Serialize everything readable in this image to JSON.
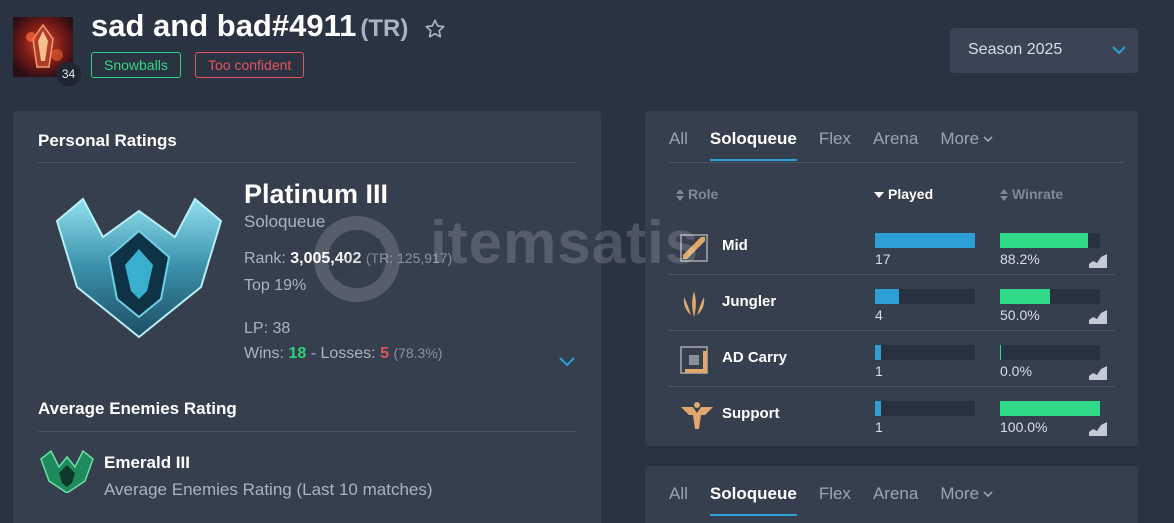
{
  "summoner": {
    "name": "sad and bad#4911",
    "region": "(TR)",
    "level": "34",
    "favorite_icon": "star-outline-icon"
  },
  "tags": [
    "Snowballs",
    "Too confident"
  ],
  "season_select": {
    "value": "Season 2025"
  },
  "personal_ratings": {
    "title": "Personal Ratings",
    "tier": "Platinum III",
    "queue": "Soloqueue",
    "rank_label": "Rank:",
    "rank_value": "3,005,402",
    "rank_region": "(TR: 125,917)",
    "top_percent": "Top 19%",
    "lp": "LP: 38",
    "wins_label": "Wins:",
    "wins": "18",
    "separator": "-",
    "losses_label": "Losses:",
    "losses": "5",
    "win_ratio": "(78.3%)"
  },
  "average_enemies": {
    "title": "Average Enemies Rating",
    "tier": "Emerald III",
    "description": "Average Enemies Rating (Last 10 matches)"
  },
  "queue_tabs": {
    "items": [
      "All",
      "Soloqueue",
      "Flex",
      "Arena",
      "More"
    ],
    "active": "Soloqueue"
  },
  "roles_table": {
    "headers": {
      "role": "Role",
      "played": "Played",
      "winrate": "Winrate"
    },
    "rows": [
      {
        "role": "Mid",
        "icon": "mid-lane-icon",
        "played": "17",
        "played_fraction": 1.0,
        "winrate": "88.2%",
        "winrate_fraction": 0.882
      },
      {
        "role": "Jungler",
        "icon": "jungle-icon",
        "played": "4",
        "played_fraction": 0.235,
        "winrate": "50.0%",
        "winrate_fraction": 0.5
      },
      {
        "role": "AD Carry",
        "icon": "bot-lane-icon",
        "played": "1",
        "played_fraction": 0.059,
        "winrate": "0.0%",
        "winrate_fraction": 0.0
      },
      {
        "role": "Support",
        "icon": "support-icon",
        "played": "1",
        "played_fraction": 0.059,
        "winrate": "100.0%",
        "winrate_fraction": 1.0
      }
    ]
  },
  "watermark": {
    "text": "itemsatis"
  },
  "colors": {
    "background": "#2a3342",
    "panel": "#363f4e",
    "accent_blue": "#2b9fd6",
    "win_green": "#30d988",
    "loss_red": "#e2555c",
    "role_icon_gold": "#e0a86a"
  }
}
